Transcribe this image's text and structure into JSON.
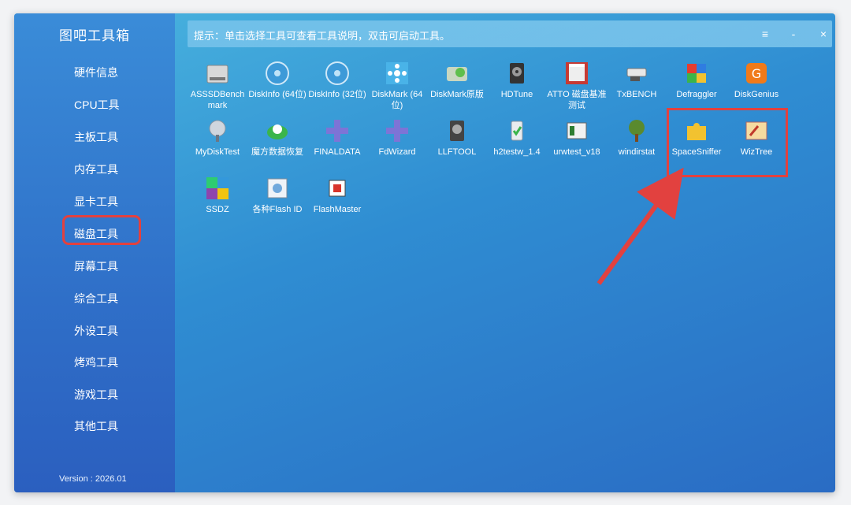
{
  "app": {
    "title": "图吧工具箱",
    "version": "Version : 2026.01"
  },
  "tip": {
    "text": "提示：单击选择工具可查看工具说明，双击可启动工具。"
  },
  "window_controls": {
    "menu": "≡",
    "minimize": "-",
    "close": "×"
  },
  "sidebar": {
    "items": [
      {
        "label": "硬件信息"
      },
      {
        "label": "CPU工具"
      },
      {
        "label": "主板工具"
      },
      {
        "label": "内存工具"
      },
      {
        "label": "显卡工具"
      },
      {
        "label": "磁盘工具",
        "selected": true
      },
      {
        "label": "屏幕工具"
      },
      {
        "label": "综合工具"
      },
      {
        "label": "外设工具"
      },
      {
        "label": "烤鸡工具"
      },
      {
        "label": "游戏工具"
      },
      {
        "label": "其他工具"
      }
    ]
  },
  "tools": [
    {
      "label": "ASSSDBench mark",
      "icon": "ssd-drive-icon"
    },
    {
      "label": "DiskInfo (64位)",
      "icon": "diskinfo-64-icon"
    },
    {
      "label": "DiskInfo (32位)",
      "icon": "diskinfo-32-icon"
    },
    {
      "label": "DiskMark (64位)",
      "icon": "diskmark-64-icon"
    },
    {
      "label": "DiskMark原版",
      "icon": "diskmark-original-icon"
    },
    {
      "label": "HDTune",
      "icon": "hdtune-icon"
    },
    {
      "label": "ATTO 磁盘基准测试",
      "icon": "atto-icon"
    },
    {
      "label": "TxBENCH",
      "icon": "txbench-icon"
    },
    {
      "label": "Defraggler",
      "icon": "defraggler-icon"
    },
    {
      "label": "DiskGenius",
      "icon": "diskgenius-icon"
    },
    {
      "label": "MyDiskTest",
      "icon": "mydisktest-icon"
    },
    {
      "label": "魔方数据恢复",
      "icon": "mofang-recovery-icon"
    },
    {
      "label": "FINALDATA",
      "icon": "finaldata-icon"
    },
    {
      "label": "FdWizard",
      "icon": "fdwizard-icon"
    },
    {
      "label": "LLFTOOL",
      "icon": "llftool-icon"
    },
    {
      "label": "h2testw_1.4",
      "icon": "h2testw-icon"
    },
    {
      "label": "urwtest_v18",
      "icon": "urwtest-icon"
    },
    {
      "label": "windirstat",
      "icon": "windirstat-icon"
    },
    {
      "label": "SpaceSniffer",
      "icon": "spacesniffer-icon"
    },
    {
      "label": "WizTree",
      "icon": "wiztree-icon"
    },
    {
      "label": "SSDZ",
      "icon": "ssdz-icon"
    },
    {
      "label": "各种Flash ID",
      "icon": "flash-id-icon"
    },
    {
      "label": "FlashMaster",
      "icon": "flashmaster-icon"
    }
  ],
  "colors": {
    "highlight": "#e2413f",
    "text": "#ffffff"
  }
}
